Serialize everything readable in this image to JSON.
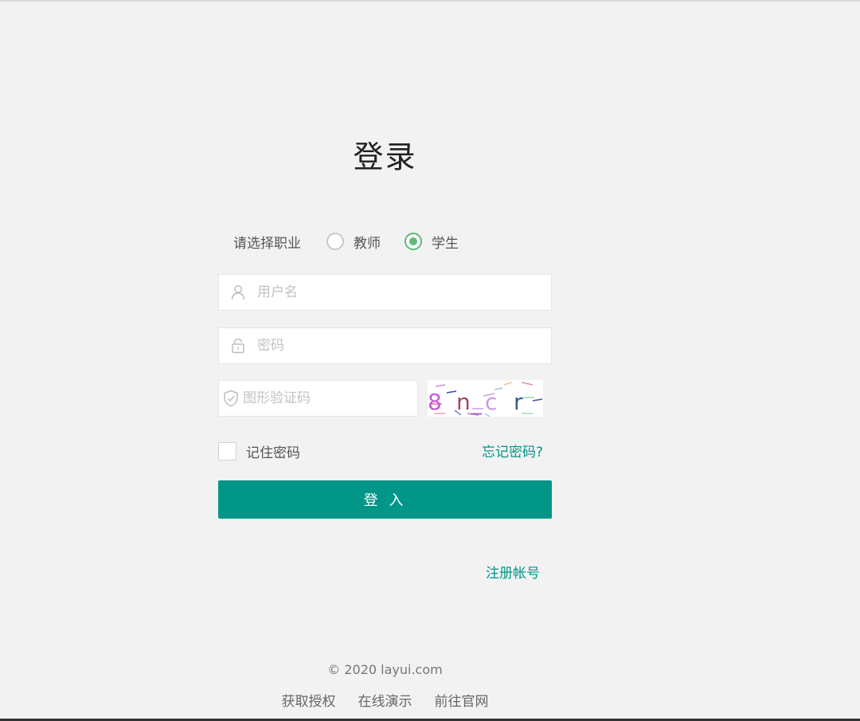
{
  "page": {
    "title": "登录"
  },
  "role": {
    "label": "请选择职业",
    "options": [
      {
        "label": "教师",
        "checked": false
      },
      {
        "label": "学生",
        "checked": true
      }
    ]
  },
  "form": {
    "username_placeholder": "用户名",
    "password_placeholder": "密码",
    "captcha_placeholder": "图形验证码",
    "captcha_text": "8n_c r"
  },
  "remember": {
    "label": "记住密码"
  },
  "links": {
    "forgot": "忘记密码?",
    "register": "注册帐号"
  },
  "login_button": {
    "label": "登 入"
  },
  "footer": {
    "copyright": "© 2020  layui.com",
    "links": [
      "获取授权",
      "在线演示",
      "前往官网"
    ]
  },
  "colors": {
    "accent": "#009688",
    "radio_checked": "#5fb878",
    "background": "#f2f2f2"
  },
  "icons": {
    "username": "user-icon",
    "password": "lock-icon",
    "captcha": "shield-check-icon"
  }
}
